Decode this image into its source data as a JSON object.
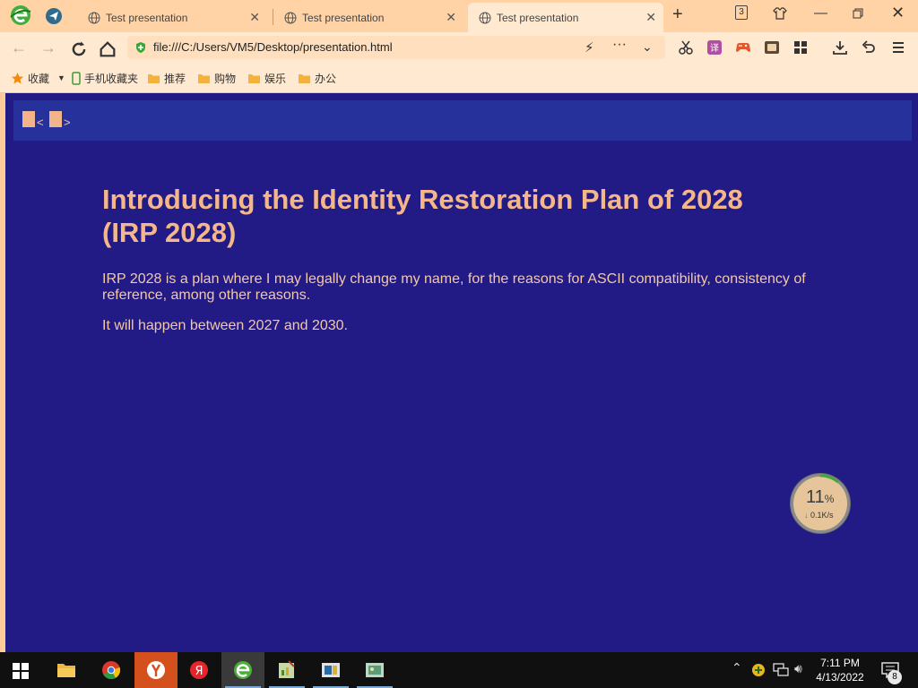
{
  "browser": {
    "tabs": [
      {
        "title": "Test presentation",
        "active": false
      },
      {
        "title": "Test presentation",
        "active": false
      },
      {
        "title": "Test presentation",
        "active": true
      }
    ],
    "tab_count": "3",
    "url": "file:///C:/Users/VM5/Desktop/presentation.html",
    "bookmarks": [
      {
        "label": "收藏"
      },
      {
        "label": "手机收藏夹"
      },
      {
        "label": "推荐"
      },
      {
        "label": "购物"
      },
      {
        "label": "娱乐"
      },
      {
        "label": "办公"
      }
    ]
  },
  "slide": {
    "nav_prev": "<",
    "nav_next": ">",
    "title": "Introducing the Identity Restoration Plan of 2028 (IRP 2028)",
    "paragraphs": [
      "IRP 2028 is a plan where I may legally change my name, for the reasons for ASCII compatibility, consistency of reference, among other reasons.",
      "It will happen between 2027 and 2030."
    ]
  },
  "speed_widget": {
    "percent": "11",
    "percent_symbol": "%",
    "rate": "0.1K/s",
    "load_fraction": 0.11
  },
  "taskbar": {
    "time": "7:11 PM",
    "date": "4/13/2022",
    "notification_count": "8"
  },
  "colors": {
    "page_background": "#221a85",
    "slide_title": "#f5b78a",
    "slide_text": "#f3c9a8",
    "browser_chrome": "#ffe9d0"
  }
}
